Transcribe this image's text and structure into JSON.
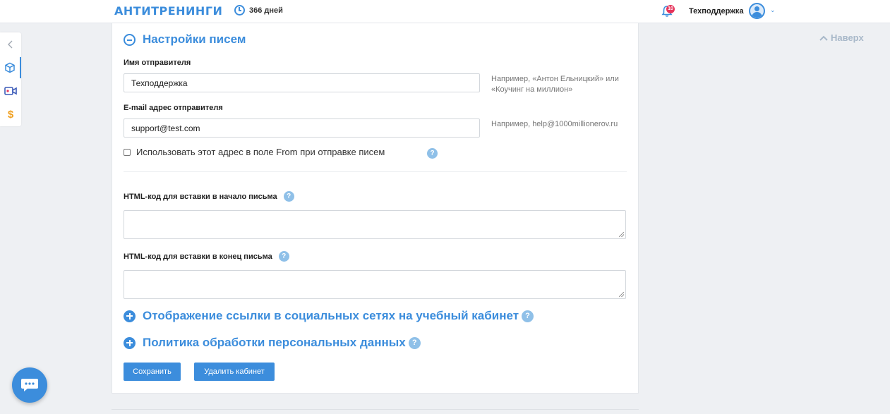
{
  "header": {
    "logo": "АНТИТРЕНИНГИ",
    "days": "366 дней",
    "notifications_count": "10",
    "username": "Техподдержка"
  },
  "sidebar": {
    "icons": [
      "chevron-left-icon",
      "box-icon",
      "video-icon",
      "dollar-icon"
    ],
    "active_index": 1
  },
  "to_top": "Наверх",
  "main": {
    "section_title": "Настройки писем",
    "sender_name": {
      "label": "Имя отправителя",
      "value": "Техподдержка",
      "hint": "Например, «Антон Ельницкий» или «Коучинг на миллион»"
    },
    "sender_email": {
      "label": "E-mail адрес отправителя",
      "value": "support@test.com",
      "hint": "Например, help@1000millionerov.ru"
    },
    "use_from_checkbox": {
      "label": "Использовать этот адрес в поле From при отправке писем",
      "checked": false
    },
    "html_header": {
      "label": "HTML-код для вставки в начало письма",
      "value": ""
    },
    "html_footer": {
      "label": "HTML-код для вставки в конец письма",
      "value": ""
    },
    "collapsed_sections": [
      "Отображение ссылки в социальных сетях на учебный кабинет",
      "Политика обработки персональных данных"
    ],
    "buttons": {
      "save": "Сохранить",
      "delete": "Удалить кабинет"
    }
  },
  "colors": {
    "accent": "#3c8ddc",
    "help_icon": "#8fc0e8",
    "badge": "#e6335a",
    "background": "#eef0f3"
  }
}
